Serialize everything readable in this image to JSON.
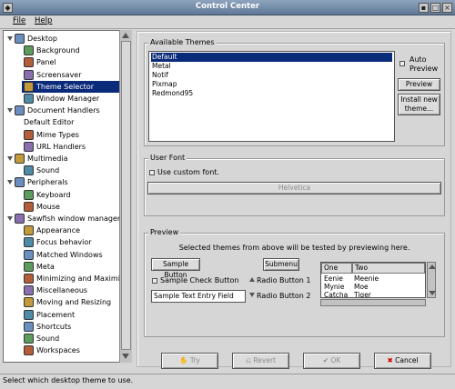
{
  "window": {
    "title": "Control Center"
  },
  "menubar": {
    "items": [
      {
        "label": "File"
      },
      {
        "label": "Help"
      }
    ]
  },
  "tree": {
    "items": [
      {
        "label": "Desktop",
        "level": 0,
        "expanded": true,
        "icon": "desktop-icon"
      },
      {
        "label": "Background",
        "level": 1,
        "icon": "background-icon"
      },
      {
        "label": "Panel",
        "level": 1,
        "icon": "panel-icon"
      },
      {
        "label": "Screensaver",
        "level": 1,
        "icon": "screensaver-icon"
      },
      {
        "label": "Theme Selector",
        "level": 1,
        "icon": "theme-selector-icon",
        "selected": true
      },
      {
        "label": "Window Manager",
        "level": 1,
        "icon": "window-manager-icon"
      },
      {
        "label": "Document Handlers",
        "level": 0,
        "expanded": true,
        "icon": "document-handlers-icon"
      },
      {
        "label": "Default Editor",
        "level": 1,
        "icon": ""
      },
      {
        "label": "Mime Types",
        "level": 1,
        "icon": "mime-types-icon"
      },
      {
        "label": "URL Handlers",
        "level": 1,
        "icon": "url-handlers-icon"
      },
      {
        "label": "Multimedia",
        "level": 0,
        "expanded": true,
        "icon": "multimedia-icon"
      },
      {
        "label": "Sound",
        "level": 1,
        "icon": "sound-icon"
      },
      {
        "label": "Peripherals",
        "level": 0,
        "expanded": true,
        "icon": "peripherals-icon"
      },
      {
        "label": "Keyboard",
        "level": 1,
        "icon": "keyboard-icon"
      },
      {
        "label": "Mouse",
        "level": 1,
        "icon": "mouse-icon"
      },
      {
        "label": "Sawfish window manager",
        "level": 0,
        "expanded": true,
        "icon": "sawfish-icon"
      },
      {
        "label": "Appearance",
        "level": 1,
        "icon": "appearance-icon"
      },
      {
        "label": "Focus behavior",
        "level": 1,
        "icon": "focus-behavior-icon"
      },
      {
        "label": "Matched Windows",
        "level": 1,
        "icon": "matched-windows-icon"
      },
      {
        "label": "Meta",
        "level": 1,
        "icon": "meta-icon"
      },
      {
        "label": "Minimizing and Maximizing",
        "level": 1,
        "icon": "minimizing-icon"
      },
      {
        "label": "Miscellaneous",
        "level": 1,
        "icon": "miscellaneous-icon"
      },
      {
        "label": "Moving and Resizing",
        "level": 1,
        "icon": "moving-icon"
      },
      {
        "label": "Placement",
        "level": 1,
        "icon": "placement-icon"
      },
      {
        "label": "Shortcuts",
        "level": 1,
        "icon": "shortcuts-icon"
      },
      {
        "label": "Sound",
        "level": 1,
        "icon": "sound-icon"
      },
      {
        "label": "Workspaces",
        "level": 1,
        "icon": "workspaces-icon"
      }
    ]
  },
  "themes": {
    "frame_label": "Available Themes",
    "list": [
      "Default",
      "Metal",
      "Notif",
      "Pixmap",
      "Redmond95"
    ],
    "selected_index": 0,
    "auto_preview_label": "Auto Preview",
    "preview_button": "Preview",
    "install_button": "Install new theme..."
  },
  "font": {
    "frame_label": "User Font",
    "use_custom_label": "Use custom font.",
    "font_button": "Helvetica"
  },
  "preview": {
    "frame_label": "Preview",
    "info_text": "Selected themes from above will be tested by previewing here.",
    "sample_button": "Sample Button",
    "submenu_button": "Submenu",
    "check_label": "Sample Check Button",
    "entry_value": "Sample Text Entry Field",
    "radio1": "Radio Button 1",
    "radio2": "Radio Button 2",
    "clist": {
      "headers": [
        "One",
        "Two"
      ],
      "rows": [
        [
          "Eenie",
          "Meenie"
        ],
        [
          "Mynie",
          "Moe"
        ],
        [
          "Catcha",
          "Tiger"
        ]
      ]
    }
  },
  "actions": {
    "try": "Try",
    "revert": "Revert",
    "ok": "OK",
    "cancel": "Cancel"
  },
  "status": {
    "text": "Select which desktop theme to use."
  }
}
